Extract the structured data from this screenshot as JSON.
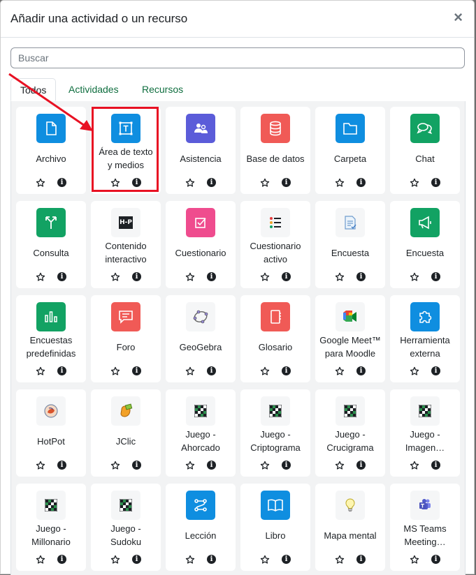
{
  "modal": {
    "title": "Añadir una actividad o un recurso",
    "close_label": "×"
  },
  "search": {
    "placeholder": "Buscar"
  },
  "tabs": [
    {
      "label": "Todos",
      "active": true
    },
    {
      "label": "Actividades",
      "active": false
    },
    {
      "label": "Recursos",
      "active": false
    }
  ],
  "colors": {
    "blue": "#0f8ee0",
    "green": "#12a263",
    "red": "#f05a56",
    "pink": "#ef4c8e",
    "purple": "#5b5cd9",
    "highlight": "#e81123"
  },
  "cards": [
    {
      "name": "archivo",
      "line1": "Archivo",
      "line2": "",
      "icon": "file-icon",
      "bg": "blue"
    },
    {
      "name": "area-texto",
      "line1": "Área de texto",
      "line2": "y medios",
      "icon": "text-area-icon",
      "bg": "blue"
    },
    {
      "name": "asistencia",
      "line1": "Asistencia",
      "line2": "",
      "icon": "attendance-icon",
      "bg": "purple"
    },
    {
      "name": "base-datos",
      "line1": "Base de datos",
      "line2": "",
      "icon": "database-icon",
      "bg": "red"
    },
    {
      "name": "carpeta",
      "line1": "Carpeta",
      "line2": "",
      "icon": "folder-icon",
      "bg": "blue"
    },
    {
      "name": "chat",
      "line1": "Chat",
      "line2": "",
      "icon": "chat-icon",
      "bg": "green"
    },
    {
      "name": "consulta",
      "line1": "Consulta",
      "line2": "",
      "icon": "choice-icon",
      "bg": "green"
    },
    {
      "name": "contenido-interactivo",
      "line1": "Contenido",
      "line2": "interactivo",
      "icon": "h5p-icon",
      "bg": "none"
    },
    {
      "name": "cuestionario",
      "line1": "Cuestionario",
      "line2": "",
      "icon": "quiz-icon",
      "bg": "pink"
    },
    {
      "name": "cuestionario-activo",
      "line1": "Cuestionario",
      "line2": "activo",
      "icon": "list-icon",
      "bg": "none"
    },
    {
      "name": "encuesta-1",
      "line1": "Encuesta",
      "line2": "",
      "icon": "survey-doc-icon",
      "bg": "none"
    },
    {
      "name": "encuesta-2",
      "line1": "Encuesta",
      "line2": "",
      "icon": "megaphone-icon",
      "bg": "green"
    },
    {
      "name": "encuestas-predefinidas",
      "line1": "Encuestas",
      "line2": "predefinidas",
      "icon": "bar-chart-icon",
      "bg": "green"
    },
    {
      "name": "foro",
      "line1": "Foro",
      "line2": "",
      "icon": "forum-icon",
      "bg": "red"
    },
    {
      "name": "geogebra",
      "line1": "GeoGebra",
      "line2": "",
      "icon": "geogebra-icon",
      "bg": "none"
    },
    {
      "name": "glosario",
      "line1": "Glosario",
      "line2": "",
      "icon": "glossary-icon",
      "bg": "red"
    },
    {
      "name": "google-meet",
      "line1": "Google Meet™",
      "line2": "para Moodle",
      "icon": "google-meet-icon",
      "bg": "none"
    },
    {
      "name": "herramienta-externa",
      "line1": "Herramienta",
      "line2": "externa",
      "icon": "puzzle-icon",
      "bg": "blue"
    },
    {
      "name": "hotpot",
      "line1": "HotPot",
      "line2": "",
      "icon": "hotpot-icon",
      "bg": "none"
    },
    {
      "name": "jclic",
      "line1": "JClic",
      "line2": "",
      "icon": "jclic-icon",
      "bg": "none"
    },
    {
      "name": "juego-ahorcado",
      "line1": "Juego -",
      "line2": "Ahorcado",
      "icon": "game-grid-icon",
      "bg": "none"
    },
    {
      "name": "juego-criptograma",
      "line1": "Juego -",
      "line2": "Criptograma",
      "icon": "game-grid-icon",
      "bg": "none"
    },
    {
      "name": "juego-crucigrama",
      "line1": "Juego -",
      "line2": "Crucigrama",
      "icon": "game-grid-icon",
      "bg": "none"
    },
    {
      "name": "juego-imagen",
      "line1": "Juego -",
      "line2": "Imagen…",
      "icon": "game-grid-icon",
      "bg": "none"
    },
    {
      "name": "juego-millonario",
      "line1": "Juego -",
      "line2": "Millonario",
      "icon": "game-grid-icon",
      "bg": "none"
    },
    {
      "name": "juego-sudoku",
      "line1": "Juego -",
      "line2": "Sudoku",
      "icon": "game-grid-icon",
      "bg": "none"
    },
    {
      "name": "leccion",
      "line1": "Lección",
      "line2": "",
      "icon": "lesson-icon",
      "bg": "blue"
    },
    {
      "name": "libro",
      "line1": "Libro",
      "line2": "",
      "icon": "book-icon",
      "bg": "blue"
    },
    {
      "name": "mapa-mental",
      "line1": "Mapa mental",
      "line2": "",
      "icon": "lightbulb-icon",
      "bg": "none"
    },
    {
      "name": "ms-teams",
      "line1": "MS Teams",
      "line2": "Meeting…",
      "icon": "teams-icon",
      "bg": "none"
    }
  ]
}
